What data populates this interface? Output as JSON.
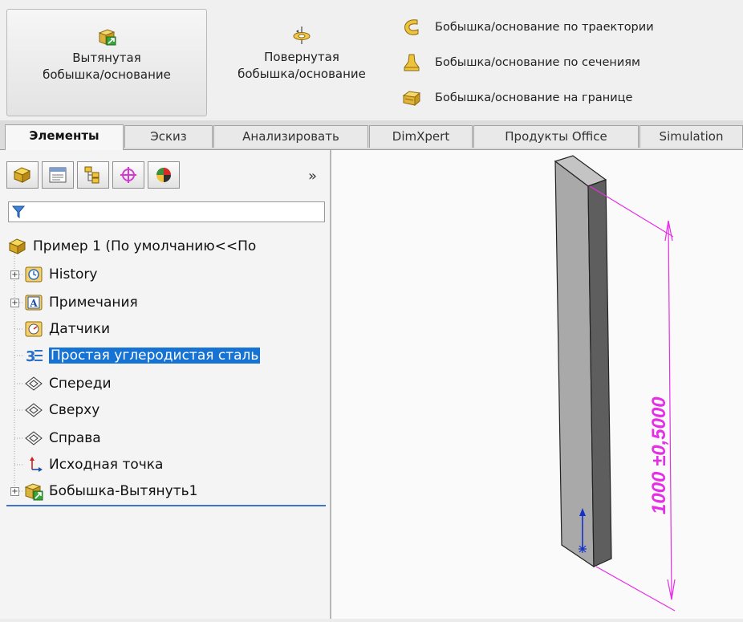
{
  "ribbon": {
    "extrude_line1": "Вытянутая",
    "extrude_line2": "бобышка/основание",
    "revolve_line1": "Повернутая",
    "revolve_line2": "бобышка/основание",
    "swept": "Бобышка/основание по траектории",
    "lofted": "Бобышка/основание по сечениям",
    "boundary": "Бобышка/основание на границе",
    "icons": [
      "extruded-boss-icon",
      "revolved-boss-icon",
      "swept-boss-icon",
      "lofted-boss-icon",
      "boundary-boss-icon"
    ]
  },
  "tabs": [
    {
      "label": "Элементы",
      "active": true
    },
    {
      "label": "Эскиз"
    },
    {
      "label": "Анализировать"
    },
    {
      "label": "DimXpert"
    },
    {
      "label": "Продукты Office"
    },
    {
      "label": "Simulation"
    }
  ],
  "panel": {
    "tab_icons": [
      "feature-manager-icon",
      "property-manager-icon",
      "configuration-manager-icon",
      "dimxpert-manager-icon",
      "display-manager-icon"
    ],
    "more": "»"
  },
  "tree": {
    "root": "Пример 1  (По умолчанию<<По",
    "items": [
      {
        "label": "History",
        "icon": "history-icon"
      },
      {
        "label": "Примечания",
        "icon": "annotations-icon"
      },
      {
        "label": "Датчики",
        "icon": "sensors-icon"
      },
      {
        "label": "Простая углеродистая сталь",
        "icon": "material-icon",
        "selected": true
      },
      {
        "label": "Спереди",
        "icon": "plane-icon"
      },
      {
        "label": "Сверху",
        "icon": "plane-icon"
      },
      {
        "label": "Справа",
        "icon": "plane-icon"
      },
      {
        "label": "Исходная точка",
        "icon": "origin-icon"
      },
      {
        "label": "Бобышка-Вытянуть1",
        "icon": "extrude-feature-icon"
      }
    ]
  },
  "viewport": {
    "dimension_text": "1000 ±0,5000",
    "colors": {
      "dimension": "#e62ee6",
      "body_front": "#a9a9a9",
      "body_side": "#5e5e5e",
      "body_top": "#c4c4c4",
      "selection": "#1673d4"
    }
  }
}
